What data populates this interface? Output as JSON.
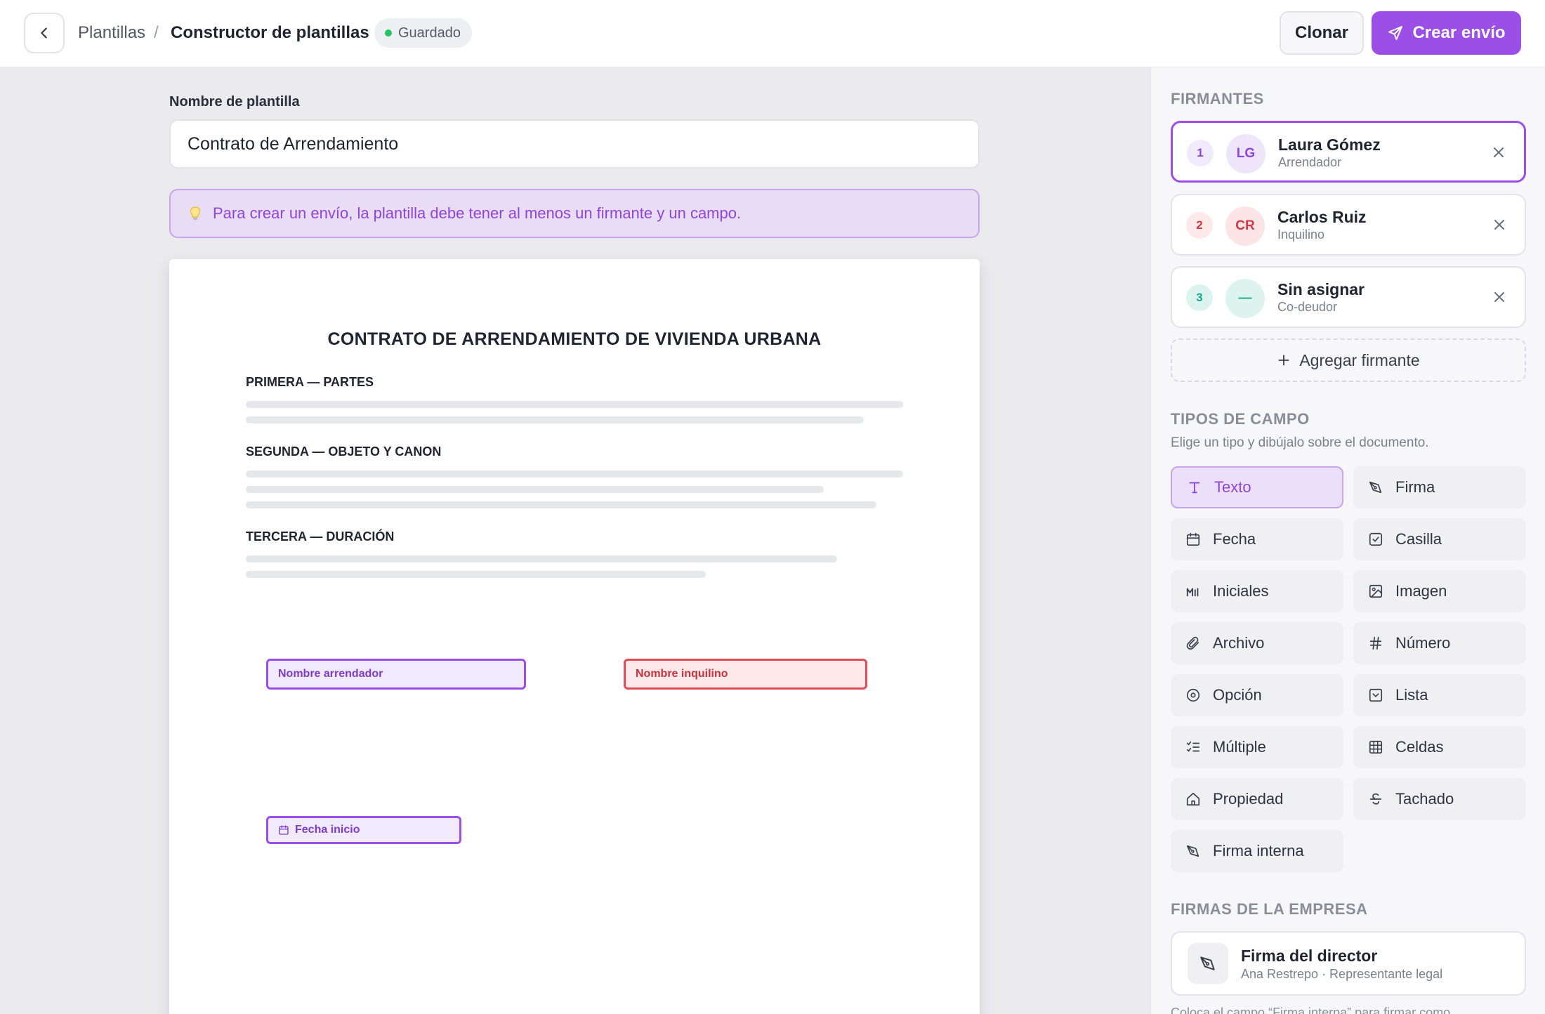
{
  "header": {
    "breadcrumb_root": "Plantillas",
    "breadcrumb_sep": "/",
    "breadcrumb_current": "Constructor de plantillas",
    "status_badge": "Guardado",
    "clone_label": "Clonar",
    "create_label": "Crear envío"
  },
  "main": {
    "template_name_label": "Nombre de plantilla",
    "template_name_value": "Contrato de Arrendamiento",
    "hint_icon": "lightbulb-icon",
    "hint_text": "Para crear un envío, la plantilla debe tener al menos un firmante y un campo.",
    "document": {
      "title": "CONTRATO DE ARRENDAMIENTO DE VIVIENDA URBANA",
      "sections": [
        "PRIMERA — PARTES",
        "SEGUNDA — OBJETO Y CANON",
        "TERCERA — DURACIÓN"
      ],
      "fields": [
        {
          "label": "Nombre arrendador",
          "signer": 1
        },
        {
          "label": "Nombre inquilino",
          "signer": 2
        },
        {
          "label": "Fecha inicio",
          "signer": 1,
          "icon": "calendar-icon"
        }
      ]
    }
  },
  "sidebar": {
    "signers_title": "FIRMANTES",
    "signers": [
      {
        "num": "1",
        "initials": "LG",
        "name": "Laura Gómez",
        "role": "Arrendador",
        "color": "#9b4fe6",
        "selected": true
      },
      {
        "num": "2",
        "initials": "CR",
        "name": "Carlos Ruiz",
        "role": "Inquilino",
        "color": "#e34b55",
        "selected": false
      },
      {
        "num": "3",
        "initials": "—",
        "name": "Sin asignar",
        "role": "Co-deudor",
        "color": "#14a88a",
        "selected": false
      }
    ],
    "add_signer_label": "Agregar firmante",
    "field_types_title": "TIPOS DE CAMPO",
    "field_types_subtitle": "Elige un tipo y dibújalo sobre el documento.",
    "field_types": [
      {
        "label": "Texto",
        "icon": "text-icon",
        "active": true
      },
      {
        "label": "Firma",
        "icon": "signature-pen-icon"
      },
      {
        "label": "Fecha",
        "icon": "calendar-icon"
      },
      {
        "label": "Casilla",
        "icon": "checkbox-icon"
      },
      {
        "label": "Iniciales",
        "icon": "initials-icon"
      },
      {
        "label": "Imagen",
        "icon": "image-icon"
      },
      {
        "label": "Archivo",
        "icon": "paperclip-icon"
      },
      {
        "label": "Número",
        "icon": "hash-icon"
      },
      {
        "label": "Opción",
        "icon": "radio-icon"
      },
      {
        "label": "Lista",
        "icon": "dropdown-icon"
      },
      {
        "label": "Múltiple",
        "icon": "checklist-icon"
      },
      {
        "label": "Celdas",
        "icon": "grid-icon"
      },
      {
        "label": "Propiedad",
        "icon": "home-icon"
      },
      {
        "label": "Tachado",
        "icon": "strikethrough-icon"
      },
      {
        "label": "Firma interna",
        "icon": "signature-pen-icon"
      }
    ],
    "company_title": "FIRMAS DE LA EMPRESA",
    "company_signature": {
      "name": "Firma del director",
      "role": "Ana Restrepo · Representante legal"
    },
    "company_note": "Coloca el campo “Firma interna” para firmar como..."
  },
  "colors": {
    "accent": "#9b4fe6",
    "signer_2": "#e34b55",
    "signer_3": "#14a88a",
    "saved": "#22c55e"
  }
}
